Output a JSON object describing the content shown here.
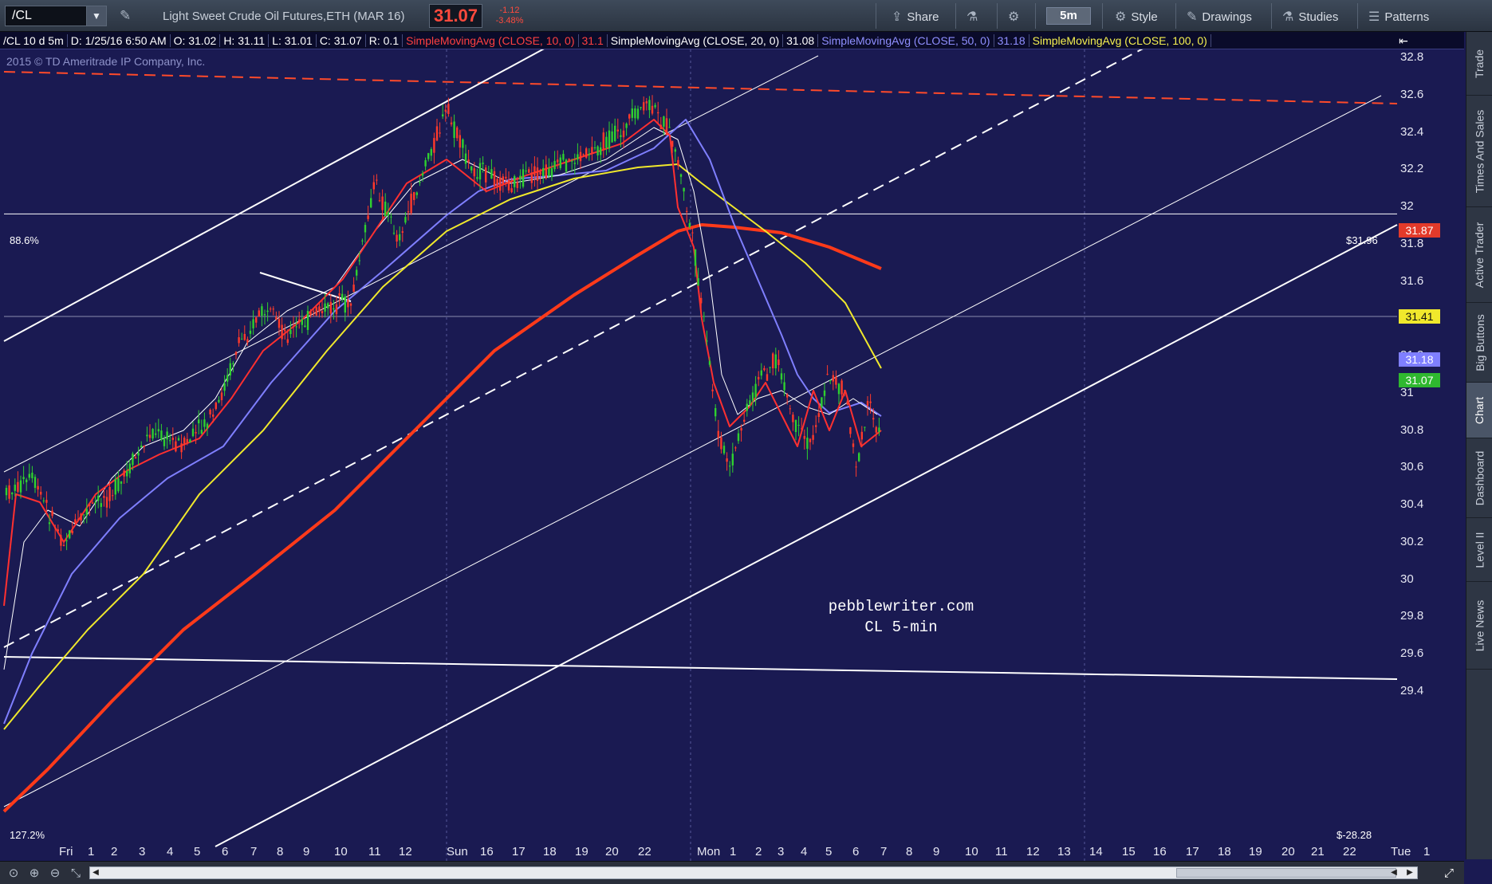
{
  "toolbar": {
    "symbol": "/CL",
    "description": "Light Sweet Crude Oil Futures,ETH (MAR 16)",
    "last": "31.07",
    "change": "-1.12",
    "change_pct": "-3.48%",
    "share": "Share",
    "timeframe": "5m",
    "style": "Style",
    "drawings": "Drawings",
    "studies": "Studies",
    "patterns": "Patterns"
  },
  "info": {
    "period": "/CL 10 d 5m",
    "date": "D: 1/25/16 6:50 AM",
    "open": "O: 31.02",
    "high": "H: 31.11",
    "low": "L: 31.01",
    "close": "C: 31.07",
    "range": "R: 0.1",
    "sma10_label": "SimpleMovingAvg (CLOSE, 10, 0)",
    "sma10_val": "31.1",
    "sma20_label": "SimpleMovingAvg (CLOSE, 20, 0)",
    "sma20_val": "31.08",
    "sma50_label": "SimpleMovingAvg (CLOSE, 50, 0)",
    "sma50_val": "31.18",
    "sma100_label": "SimpleMovingAvg (CLOSE, 100, 0)"
  },
  "sidebar": [
    "Trade",
    "Times And Sales",
    "Active Trader",
    "Big Buttons",
    "Chart",
    "Dashboard",
    "Level II",
    "Live News"
  ],
  "chart": {
    "copyright": "2015 © TD Ameritrade IP Company, Inc.",
    "fib_high_label": "88.6%",
    "fib_low_label": "127.2%",
    "fib_price_label": "$31.96",
    "fib_low_price_label": "$-28.28",
    "watermark_line1": "pebblewriter.com",
    "watermark_line2": "CL 5-min",
    "price_badges": [
      {
        "text": "31.87",
        "bg": "#e33a2a",
        "fg": "#ffffff"
      },
      {
        "text": "31.41",
        "bg": "#f0e82c",
        "fg": "#111111"
      },
      {
        "text": "31.18",
        "bg": "#7f7fff",
        "fg": "#ffffff"
      },
      {
        "text": "31.07",
        "bg": "#2fb82f",
        "fg": "#ffffff"
      }
    ],
    "y_ticks": [
      "32.8",
      "32.6",
      "32.4",
      "32.2",
      "32",
      "31.8",
      "31.6",
      "31.4",
      "31.2",
      "31",
      "30.8",
      "30.6",
      "30.4",
      "30.2",
      "30",
      "29.8",
      "29.6",
      "29.4"
    ],
    "x_ticks": [
      "Fri",
      "1",
      "2",
      "3",
      "4",
      "5",
      "6",
      "7",
      "8",
      "9",
      "10",
      "11",
      "12",
      "Sun",
      "16",
      "17",
      "18",
      "19",
      "20",
      "22",
      "Mon",
      "1",
      "2",
      "3",
      "4",
      "5",
      "6",
      "7",
      "8",
      "9",
      "10",
      "11",
      "12",
      "13",
      "14",
      "15",
      "16",
      "17",
      "18",
      "19",
      "20",
      "21",
      "22",
      "Tue",
      "1"
    ]
  },
  "colors": {
    "background": "#1a1a52",
    "sma10": "#ff3030",
    "sma20": "#ffffff",
    "sma50": "#7f7fff",
    "sma100": "#f0e82c",
    "sma200": "#ff3a1a"
  }
}
